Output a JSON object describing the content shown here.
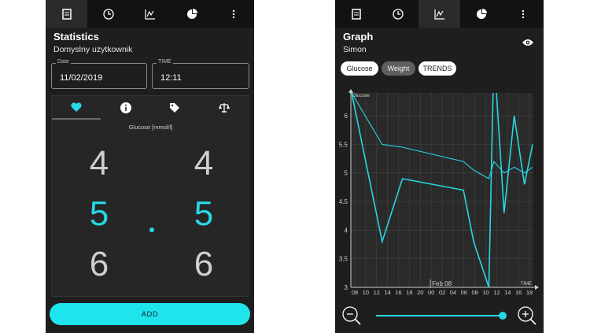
{
  "left": {
    "title": "Statistics",
    "user": "Domyslny uzytkownik",
    "date": {
      "label": "Date",
      "value": "11/02/2019"
    },
    "time": {
      "label": "TIME",
      "value": "12:11"
    },
    "unit_label": "Glucose [mmol/l]",
    "picker": {
      "integer": [
        "4",
        "5",
        "6"
      ],
      "decimal": [
        "4",
        "5",
        "6"
      ],
      "selected_value": "5.5"
    },
    "add_label": "ADD"
  },
  "right": {
    "title": "Graph",
    "user": "Simon",
    "chips": {
      "glucose": "Glucose",
      "weight": "Weight",
      "trends": "TRENDS"
    },
    "zoom_level": 1.0
  },
  "tabs": [
    "note-icon",
    "clock-icon",
    "graph-icon",
    "pie-icon",
    "more-icon"
  ],
  "colors": {
    "accent": "#27d7e3",
    "background": "#1e1e1e",
    "tabbar": "#121212"
  },
  "chart_data": {
    "type": "line",
    "ylabel": "Glucose",
    "xlabel": "TIME",
    "date_marker": "Feb 08",
    "ylim": [
      3,
      6.4
    ],
    "y_ticks": [
      "6",
      "5.5",
      "5",
      "4.5",
      "4",
      "3.5",
      "3"
    ],
    "x_tick_labels": [
      "08",
      "10",
      "12",
      "14",
      "16",
      "18",
      "20",
      "00",
      "02",
      "04",
      "06",
      "08",
      "10",
      "12",
      "14",
      "16",
      "18"
    ],
    "series": [
      {
        "values": [
          6.4,
          3.8,
          4.9,
          4.7,
          3.8,
          3.0,
          7.1,
          4.3,
          6.0,
          4.8,
          5.5
        ]
      },
      {
        "values": [
          6.4,
          5.5,
          5.45,
          5.2,
          5.05,
          4.9,
          5.2,
          5.0,
          5.1,
          5.0,
          5.1
        ]
      }
    ]
  }
}
